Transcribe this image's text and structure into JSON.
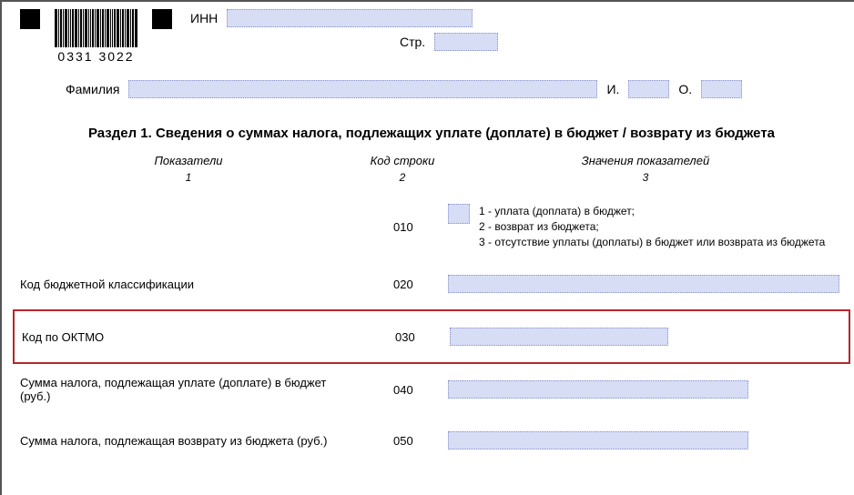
{
  "header": {
    "barcode_number": "0331 3022",
    "inn_label": "ИНН",
    "page_label": "Стр.",
    "surname_label": "Фамилия",
    "initial_i_label": "И.",
    "initial_o_label": "О."
  },
  "section_title": "Раздел 1. Сведения о суммах налога, подлежащих уплате (доплате) в бюджет / возврату из бюджета",
  "columns": {
    "indicators": "Показатели",
    "indicators_num": "1",
    "code": "Код строки",
    "code_num": "2",
    "values": "Значения показателей",
    "values_num": "3"
  },
  "rows": [
    {
      "indicator": "",
      "code": "010",
      "legend": {
        "l1": "1 - уплата (доплата) в бюджет;",
        "l2": "2 - возврат из бюджета;",
        "l3": "3 - отсутствие уплаты (доплаты) в бюджет или возврата из бюджета"
      }
    },
    {
      "indicator": "Код бюджетной классификации",
      "code": "020"
    },
    {
      "indicator": "Код по ОКТМО",
      "code": "030"
    },
    {
      "indicator": "Сумма налога, подлежащая уплате (доплате) в бюджет (руб.)",
      "code": "040"
    },
    {
      "indicator": "Сумма налога, подлежащая возврату из бюджета (руб.)",
      "code": "050"
    }
  ]
}
